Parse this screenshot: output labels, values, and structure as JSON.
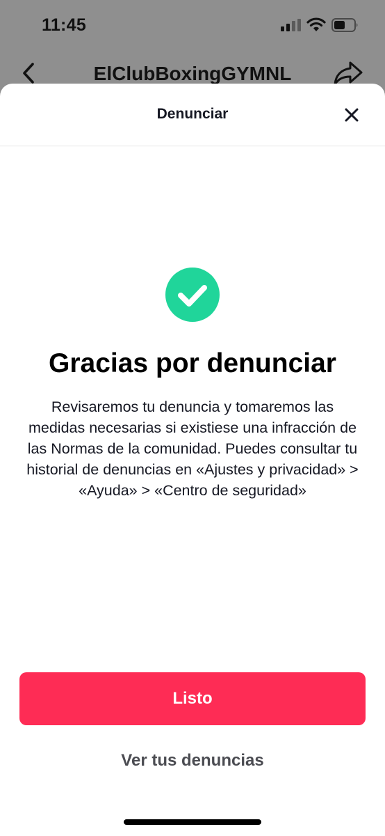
{
  "status_bar": {
    "time": "11:45"
  },
  "page": {
    "profile_name": "ElClubBoxingGYMNL"
  },
  "sheet": {
    "title": "Denunciar",
    "headline": "Gracias por denunciar",
    "body": "Revisaremos tu denuncia y tomaremos las medidas necesarias si existiese una infracción de las Normas de la comunidad. Puedes consultar tu historial de denuncias en «Ajustes y privacidad» > «Ayuda» > «Centro de seguridad»",
    "done_label": "Listo",
    "reports_link": "Ver tus denuncias"
  },
  "colors": {
    "accent": "#fe2c55",
    "success": "#20d59a",
    "backdrop": "#8f8f8f"
  },
  "icons": [
    "back-arrow-icon",
    "share-icon",
    "close-icon",
    "check-icon",
    "signal-icon",
    "wifi-icon",
    "battery-icon"
  ]
}
